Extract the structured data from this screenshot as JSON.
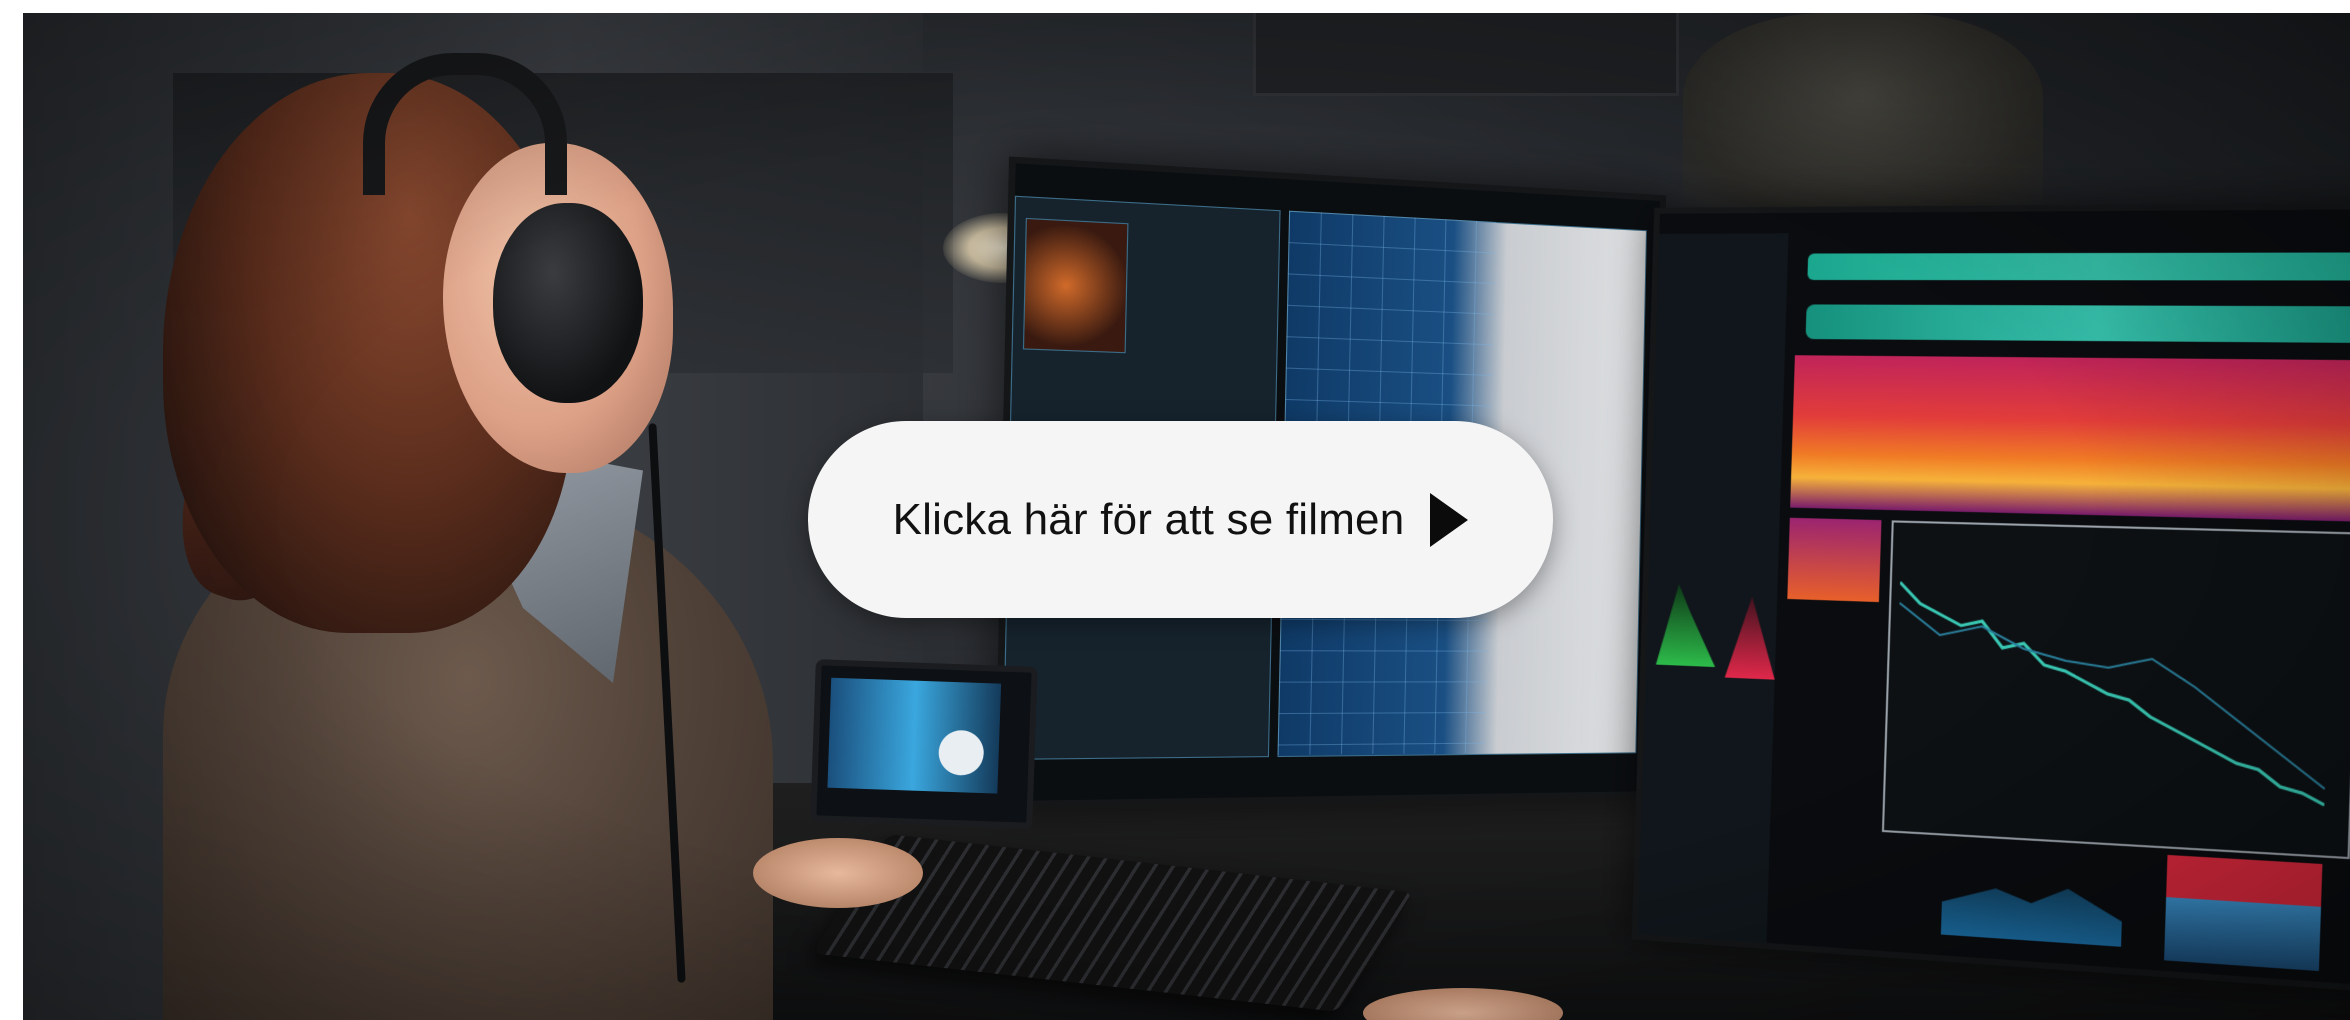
{
  "video": {
    "play_label": "Klicka här för att se filmen"
  },
  "icons": {
    "play": "play-icon"
  },
  "colors": {
    "button_bg": "#f5f5f5",
    "button_text": "#111111",
    "page_bg": "#ffffff"
  }
}
